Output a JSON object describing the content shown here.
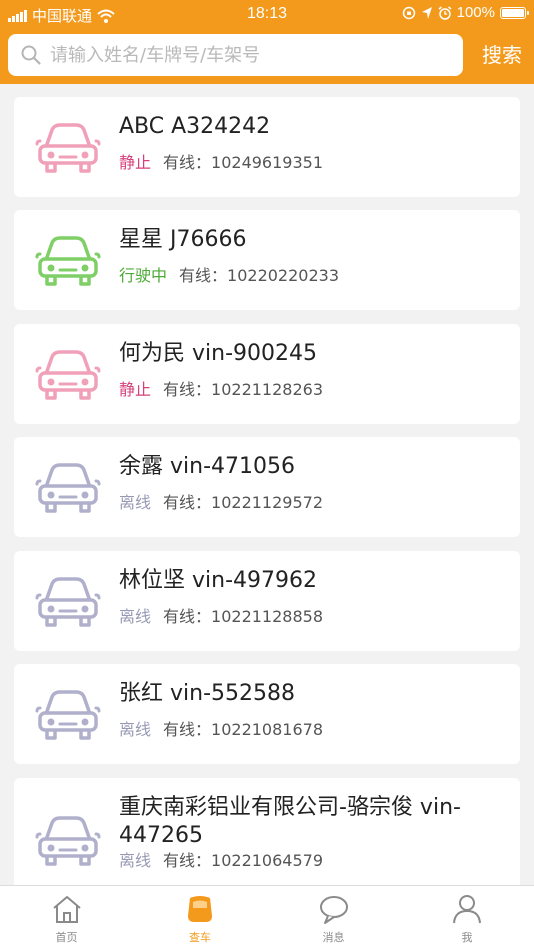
{
  "status_bar": {
    "carrier": "中国联通",
    "time": "18:13",
    "battery": "100%"
  },
  "search": {
    "placeholder": "请输入姓名/车牌号/车架号",
    "value": "",
    "button_label": "搜索"
  },
  "vehicles": [
    {
      "name": "ABC A324242",
      "status": "静止",
      "status_type": "static",
      "line_label": "有线：",
      "id": "10249619351"
    },
    {
      "name": "星星 J76666",
      "status": "行驶中",
      "status_type": "moving",
      "line_label": "有线：",
      "id": "10220220233"
    },
    {
      "name": "何为民 vin-900245",
      "status": "静止",
      "status_type": "static",
      "line_label": "有线：",
      "id": "10221128263"
    },
    {
      "name": "余露 vin-471056",
      "status": "离线",
      "status_type": "offline",
      "line_label": "有线：",
      "id": "10221129572"
    },
    {
      "name": "林位坚 vin-497962",
      "status": "离线",
      "status_type": "offline",
      "line_label": "有线：",
      "id": "10221128858"
    },
    {
      "name": "张红 vin-552588",
      "status": "离线",
      "status_type": "offline",
      "line_label": "有线：",
      "id": "10221081678"
    },
    {
      "name": "重庆南彩铝业有限公司-骆宗俊 vin-447265",
      "status": "离线",
      "status_type": "offline",
      "line_label": "有线：",
      "id": "10221064579"
    }
  ],
  "status_colors": {
    "static": "#d6417c",
    "moving": "#4caa37",
    "offline": "#9999b5"
  },
  "icon_colors": {
    "static": "#f0a0b8",
    "moving": "#7fcf66",
    "offline": "#b0b0cc"
  },
  "tabs": [
    {
      "label": "首页",
      "icon": "home-icon",
      "active": false
    },
    {
      "label": "查车",
      "icon": "car-search-icon",
      "active": true
    },
    {
      "label": "消息",
      "icon": "message-icon",
      "active": false
    },
    {
      "label": "我",
      "icon": "user-icon",
      "active": false
    }
  ],
  "theme": {
    "accent": "#f39a1c"
  }
}
